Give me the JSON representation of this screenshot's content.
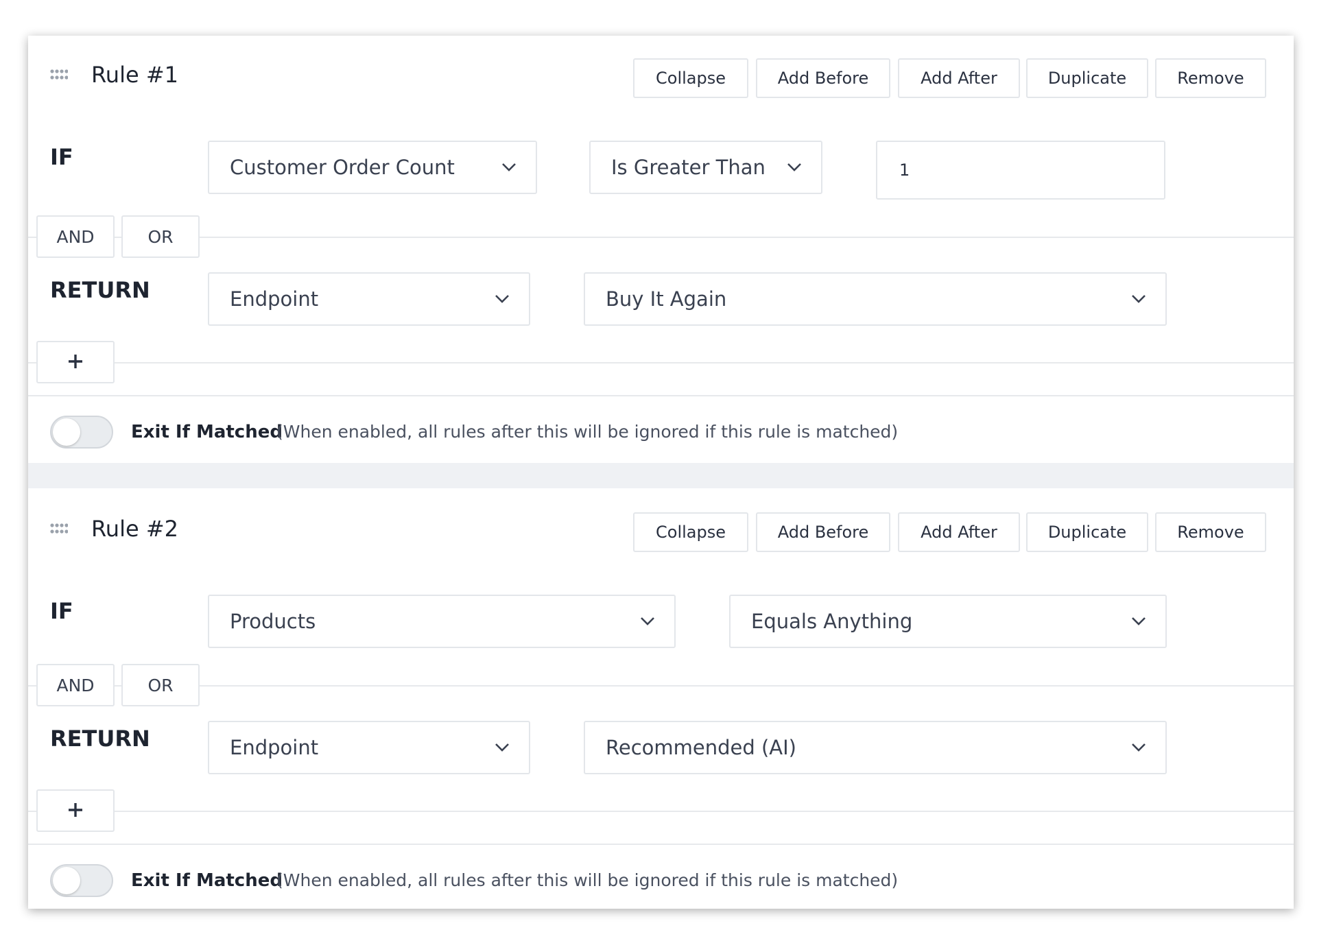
{
  "rules": [
    {
      "title": "Rule #1",
      "actions": {
        "collapse": "Collapse",
        "add_before": "Add Before",
        "add_after": "Add After",
        "duplicate": "Duplicate",
        "remove": "Remove"
      },
      "if_label": "IF",
      "condition": {
        "field": "Customer Order Count",
        "operator": "Is Greater Than",
        "value": "1"
      },
      "logic": {
        "and": "AND",
        "or": "OR"
      },
      "return_label": "RETURN",
      "return": {
        "type": "Endpoint",
        "value": "Buy It Again"
      },
      "add_icon": "plus-icon",
      "exit": {
        "label": "Exit If Matched",
        "hint": "(When enabled, all rules after this will be ignored if this rule is matched)",
        "enabled": false
      }
    },
    {
      "title": "Rule #2",
      "actions": {
        "collapse": "Collapse",
        "add_before": "Add Before",
        "add_after": "Add After",
        "duplicate": "Duplicate",
        "remove": "Remove"
      },
      "if_label": "IF",
      "condition": {
        "field": "Products",
        "operator": "Equals Anything"
      },
      "logic": {
        "and": "AND",
        "or": "OR"
      },
      "return_label": "RETURN",
      "return": {
        "type": "Endpoint",
        "value": "Recommended (AI)"
      },
      "add_icon": "plus-icon",
      "exit": {
        "label": "Exit If Matched",
        "hint": "(When enabled, all rules after this will be ignored if this rule is matched)",
        "enabled": false
      }
    }
  ],
  "icons": {
    "drag_handle": "grip-dots-icon",
    "dropdown": "chevron-down-icon",
    "add": "plus-icon"
  },
  "colors": {
    "border": "#e3e6ea",
    "divider": "#e7e9ec",
    "gap_background": "#eff1f4",
    "text": "#2a3140"
  }
}
